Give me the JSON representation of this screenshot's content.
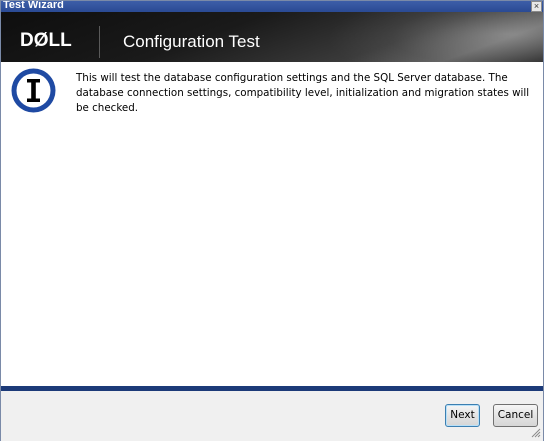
{
  "window": {
    "title": "Test Wizard",
    "close_glyph": "×"
  },
  "banner": {
    "logo": "DØLL",
    "title": "Configuration Test"
  },
  "message": {
    "icon": "info-icon",
    "text": "This will test the database configuration settings and the SQL Server database. The database connection settings, compatibility level, initialization and migration states will be checked."
  },
  "buttons": {
    "next": "Next",
    "cancel": "Cancel"
  },
  "colors": {
    "accent": "#1c3a78",
    "titlebar": "#2a4a94"
  }
}
